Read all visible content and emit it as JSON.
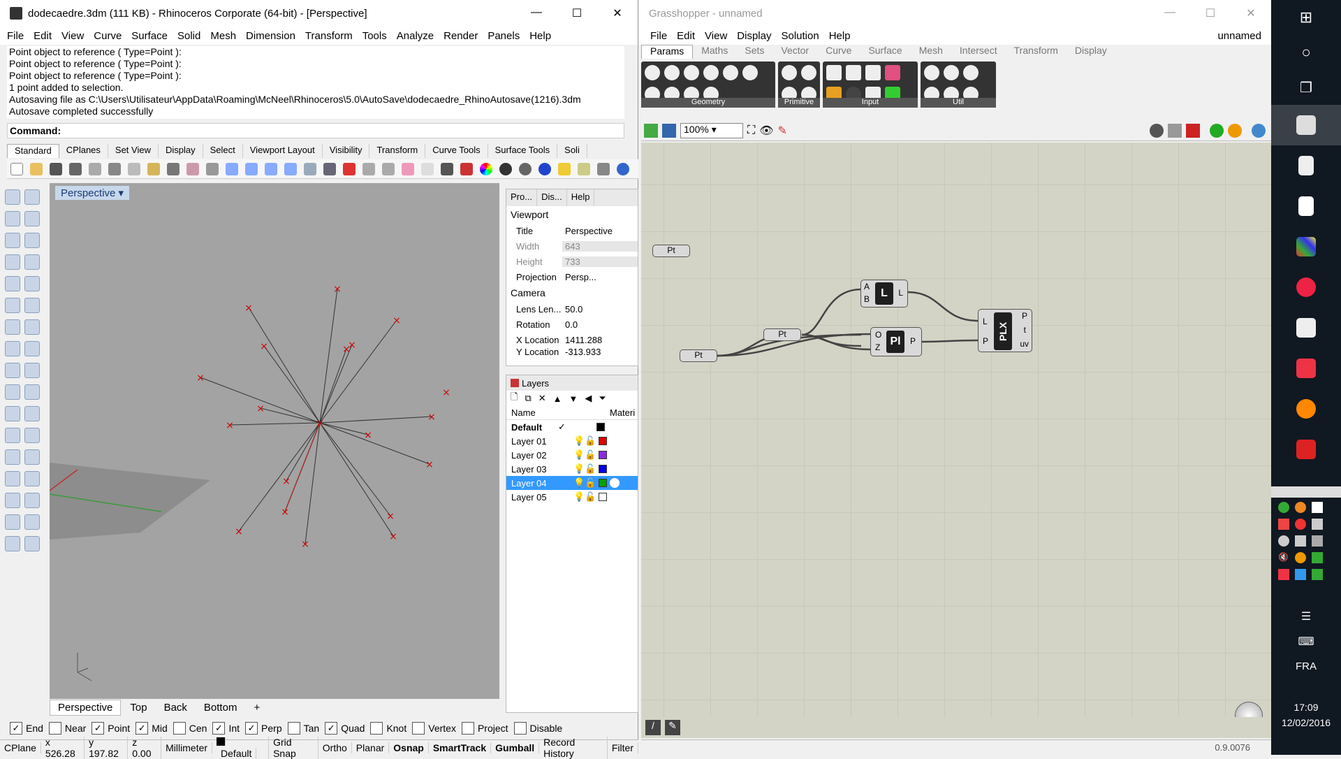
{
  "rhino": {
    "title": "dodecaedre.3dm (111 KB) - Rhinoceros Corporate (64-bit) - [Perspective]",
    "menu": [
      "File",
      "Edit",
      "View",
      "Curve",
      "Surface",
      "Solid",
      "Mesh",
      "Dimension",
      "Transform",
      "Tools",
      "Analyze",
      "Render",
      "Panels",
      "Help"
    ],
    "command_history": [
      "Point object to reference ( Type=Point ):",
      "Point object to reference ( Type=Point ):",
      "Point object to reference ( Type=Point ):",
      "1 point added to selection.",
      "Autosaving file as C:\\Users\\Utilisateur\\AppData\\Roaming\\McNeel\\Rhinoceros\\5.0\\AutoSave\\dodecaedre_RhinoAutosave(1216).3dm",
      "Autosave completed successfully"
    ],
    "command_prompt": "Command:",
    "toolbar_tabs": [
      "Standard",
      "CPlanes",
      "Set View",
      "Display",
      "Select",
      "Viewport Layout",
      "Visibility",
      "Transform",
      "Curve Tools",
      "Surface Tools",
      "Soli"
    ],
    "viewport": {
      "title": "Perspective"
    },
    "viewport_tabs": [
      "Perspective",
      "Top",
      "Back",
      "Bottom"
    ],
    "properties": {
      "tabs": [
        "Pro...",
        "Dis...",
        "Help"
      ],
      "section_viewport": "Viewport",
      "rows": [
        {
          "k": "Title",
          "v": "Perspective"
        },
        {
          "k": "Width",
          "v": "643"
        },
        {
          "k": "Height",
          "v": "733"
        },
        {
          "k": "Projection",
          "v": "Persp..."
        }
      ],
      "section_camera": "Camera",
      "camera_rows": [
        {
          "k": "Lens Len...",
          "v": "50.0"
        },
        {
          "k": "Rotation",
          "v": "0.0"
        },
        {
          "k": "X Location",
          "v": "1411.288"
        },
        {
          "k": "Y Location",
          "v": "-313.933"
        }
      ]
    },
    "layers": {
      "title": "Layers",
      "col_name": "Name",
      "col_material": "Materi",
      "rows": [
        {
          "name": "Default",
          "color": "#000000"
        },
        {
          "name": "Layer 01",
          "color": "#e00000"
        },
        {
          "name": "Layer 02",
          "color": "#8a2be2"
        },
        {
          "name": "Layer 03",
          "color": "#0000e0"
        },
        {
          "name": "Layer 04",
          "color": "#00a000"
        },
        {
          "name": "Layer 05",
          "color": "#ffffff"
        }
      ]
    },
    "osnaps": [
      {
        "label": "End",
        "checked": true
      },
      {
        "label": "Near",
        "checked": false
      },
      {
        "label": "Point",
        "checked": true
      },
      {
        "label": "Mid",
        "checked": true
      },
      {
        "label": "Cen",
        "checked": false
      },
      {
        "label": "Int",
        "checked": true
      },
      {
        "label": "Perp",
        "checked": true
      },
      {
        "label": "Tan",
        "checked": false
      },
      {
        "label": "Quad",
        "checked": true
      },
      {
        "label": "Knot",
        "checked": false
      },
      {
        "label": "Vertex",
        "checked": false
      },
      {
        "label": "Project",
        "checked": false
      },
      {
        "label": "Disable",
        "checked": false
      }
    ],
    "status": [
      "CPlane",
      "x 526.28",
      "y 197.82",
      "z 0.00",
      "Millimeter",
      "Default",
      "Grid Snap",
      "Ortho",
      "Planar",
      "Osnap",
      "SmartTrack",
      "Gumball",
      "Record History",
      "Filter"
    ]
  },
  "grasshopper": {
    "title": "Grasshopper - unnamed",
    "menu": [
      "File",
      "Edit",
      "View",
      "Display",
      "Solution",
      "Help"
    ],
    "doc_name": "unnamed",
    "tabs": [
      "Params",
      "Maths",
      "Sets",
      "Vector",
      "Curve",
      "Surface",
      "Mesh",
      "Intersect",
      "Transform",
      "Display"
    ],
    "groups": [
      "Geometry",
      "Primitive",
      "Input",
      "Util"
    ],
    "zoom": "100%",
    "version": "0.9.0076",
    "components": {
      "pt1": "Pt",
      "pt2": "Pt",
      "pt3": "Pt",
      "line": "L",
      "line_a": "A",
      "line_b": "B",
      "line_out": "L",
      "plane": "Pl",
      "plane_o": "O",
      "plane_z": "Z",
      "plane_out": "P",
      "plx": "PLX",
      "plx_in_l": "L",
      "plx_in_p": "P",
      "plx_out_p": "P",
      "plx_out_t": "t",
      "plx_out_uv": "uv"
    }
  },
  "taskbar": {
    "language": "FRA",
    "time": "17:09",
    "date": "12/02/2016"
  }
}
